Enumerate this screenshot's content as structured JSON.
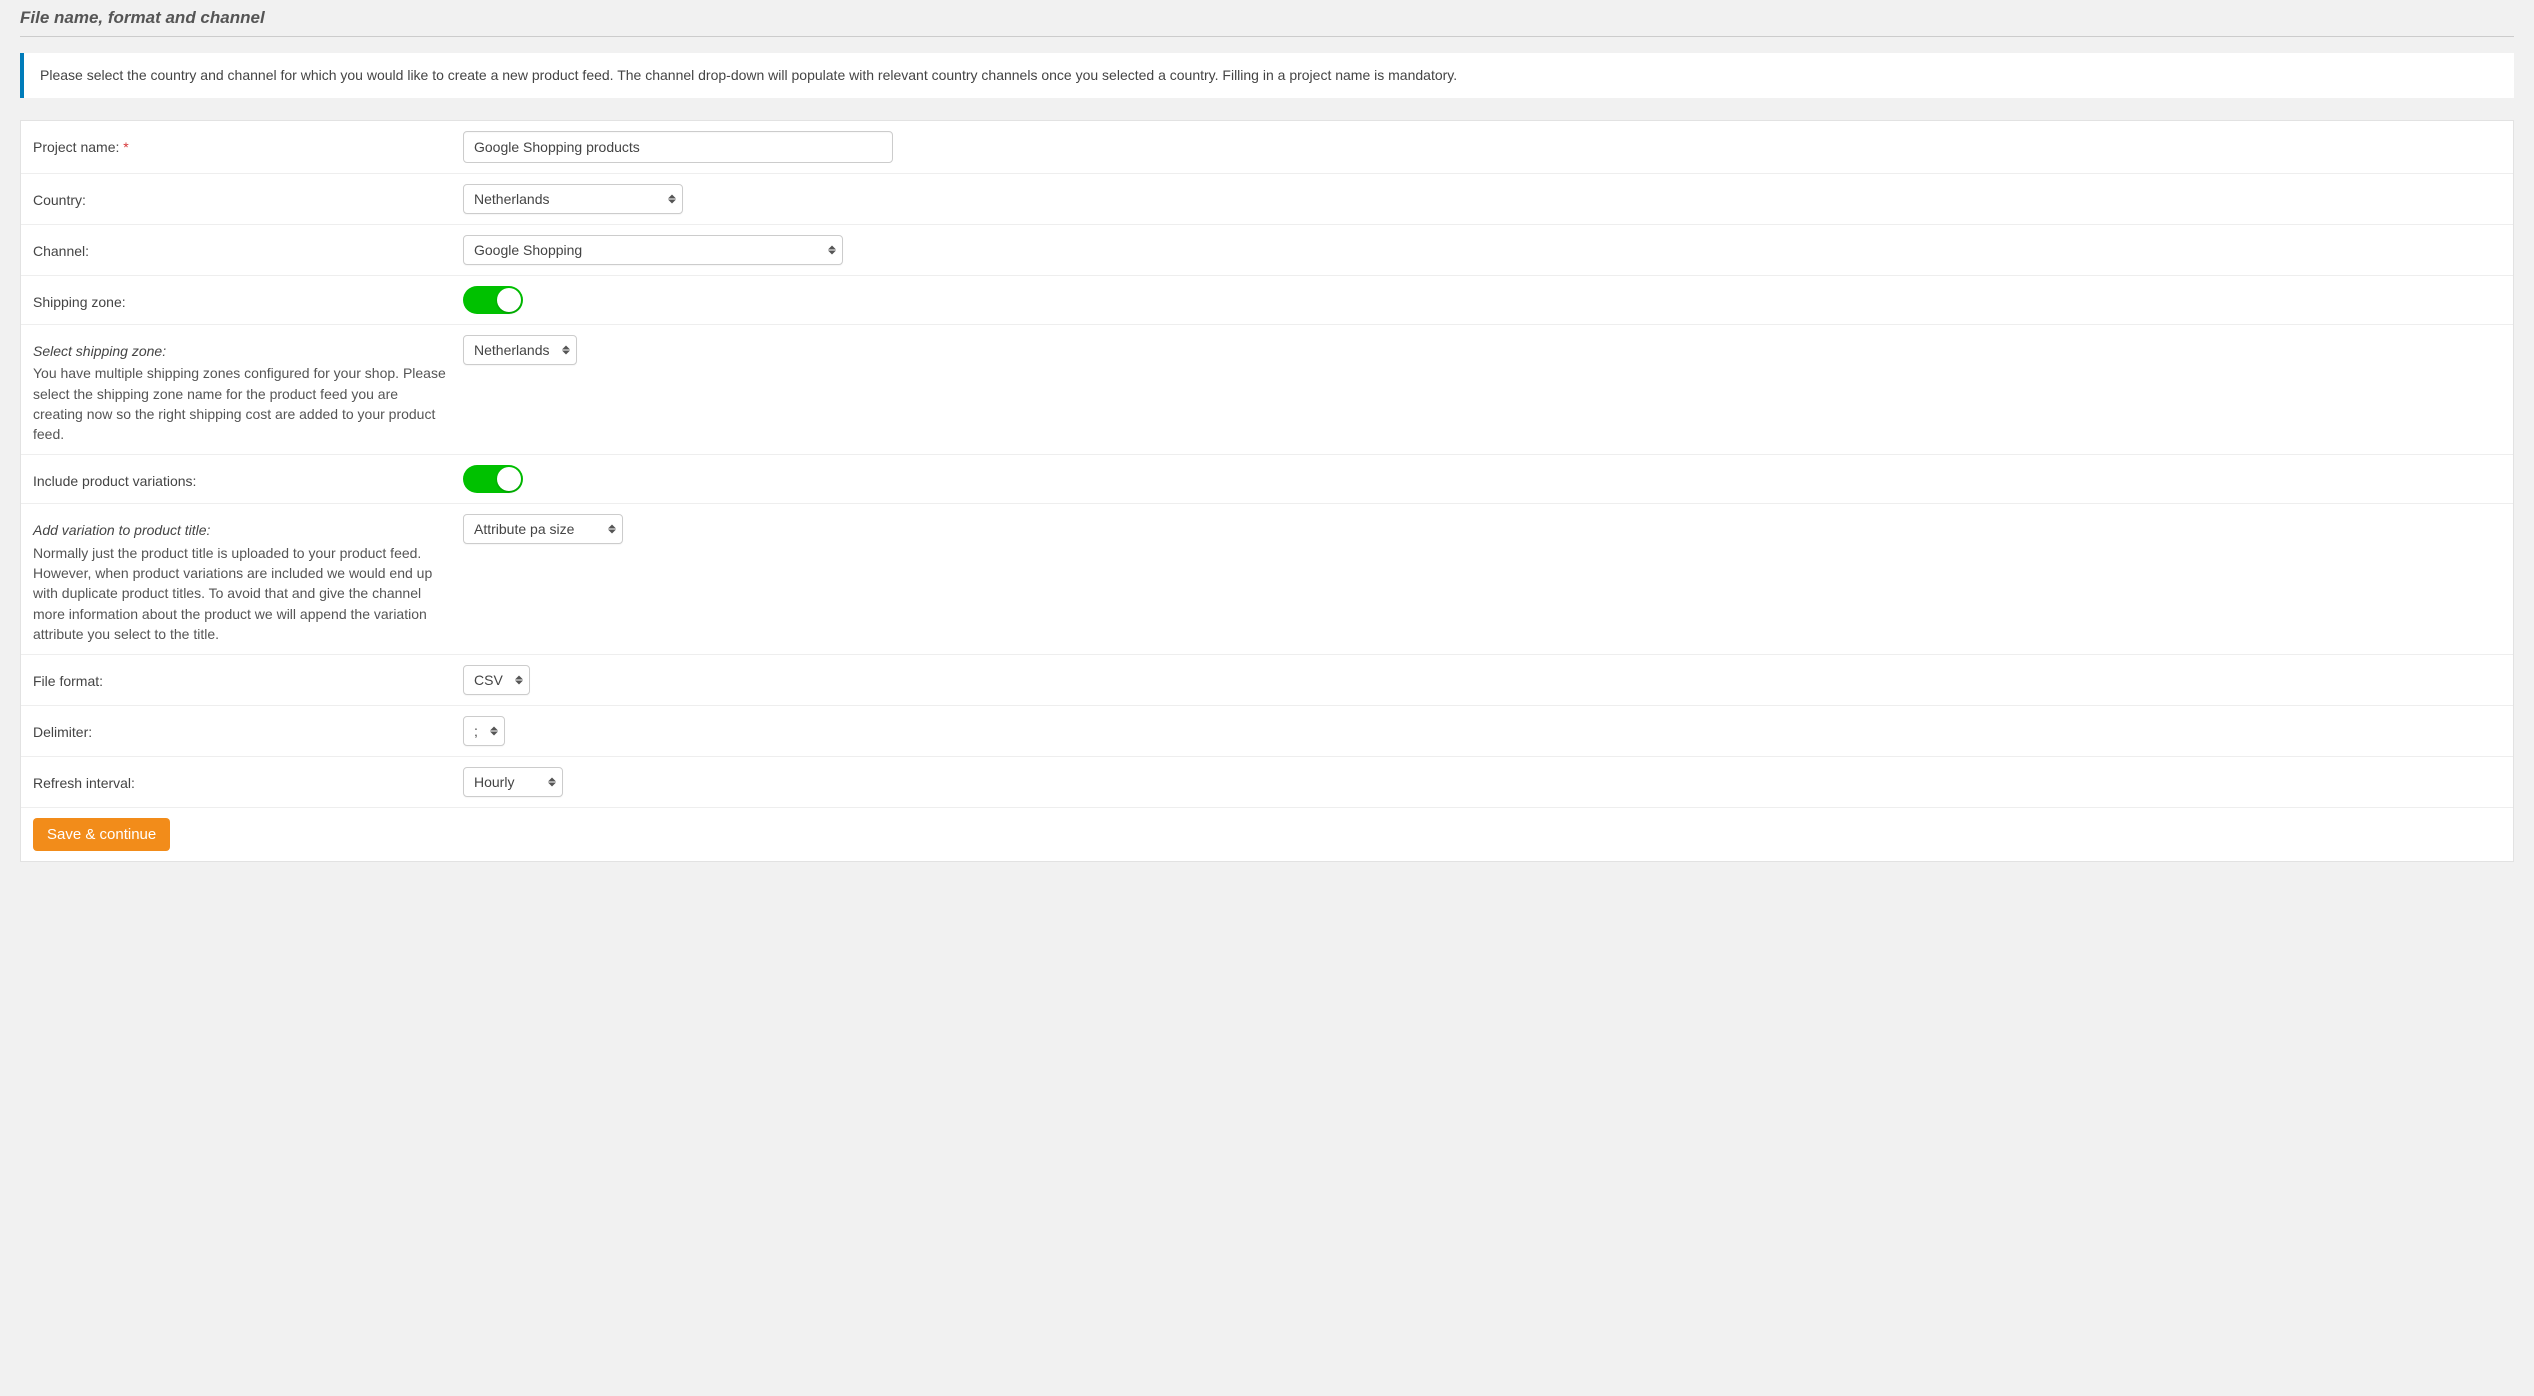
{
  "heading": "File name, format and channel",
  "info": "Please select the country and channel for which you would like to create a new product feed. The channel drop-down will populate with relevant country channels once you selected a country. Filling in a project name is mandatory.",
  "fields": {
    "project_name": {
      "label": "Project name:",
      "value": "Google Shopping products"
    },
    "country": {
      "label": "Country:",
      "value": "Netherlands"
    },
    "channel": {
      "label": "Channel:",
      "value": "Google Shopping"
    },
    "shipping_zone": {
      "label": "Shipping zone:"
    },
    "select_shipping_zone": {
      "label": "Select shipping zone:",
      "sub": "You have multiple shipping zones configured for your shop. Please select the shipping zone name for the product feed you are creating now so the right shipping cost are added to your product feed.",
      "value": "Netherlands"
    },
    "include_variations": {
      "label": "Include product variations:"
    },
    "variation_title": {
      "label": "Add variation to product title:",
      "sub": "Normally just the product title is uploaded to your product feed. However, when product variations are included we would end up with duplicate product titles. To avoid that and give the channel more information about the product we will append the variation attribute you select to the title.",
      "value": "Attribute pa size"
    },
    "file_format": {
      "label": "File format:",
      "value": "CSV"
    },
    "delimiter": {
      "label": "Delimiter:",
      "value": ";"
    },
    "refresh_interval": {
      "label": "Refresh interval:",
      "value": "Hourly"
    }
  },
  "save_label": "Save & continue"
}
